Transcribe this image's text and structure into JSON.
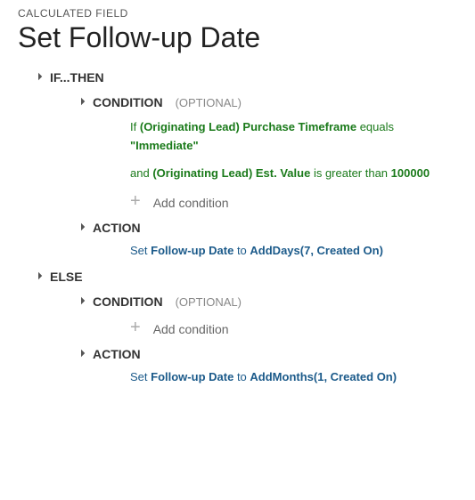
{
  "breadcrumb": "CALCULATED FIELD",
  "title": "Set Follow-up Date",
  "labels": {
    "if_then": "IF...THEN",
    "else": "ELSE",
    "condition": "CONDITION",
    "optional": "(OPTIONAL)",
    "action": "ACTION",
    "add_condition": "Add condition"
  },
  "if_block": {
    "conditions": [
      {
        "prefix": "If",
        "field": "(Originating Lead) Purchase Timeframe",
        "op": "equals",
        "value": "\"Immediate\""
      },
      {
        "prefix": "and",
        "field": "(Originating Lead) Est. Value",
        "op": "is greater than",
        "value": "100000"
      }
    ],
    "action": {
      "prefix": "Set",
      "field": "Follow-up Date",
      "mid": "to",
      "func": "AddDays(7, Created On)"
    }
  },
  "else_block": {
    "action": {
      "prefix": "Set",
      "field": "Follow-up Date",
      "mid": "to",
      "func": "AddMonths(1, Created On)"
    }
  }
}
